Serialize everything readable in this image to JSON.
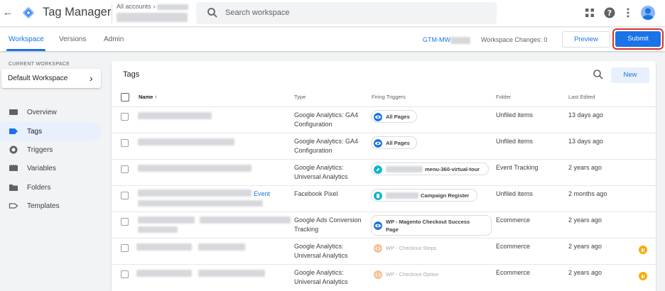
{
  "app": {
    "title": "Tag Manager",
    "accounts_label": "All accounts"
  },
  "search": {
    "placeholder": "Search workspace"
  },
  "subnav": {
    "tabs": [
      {
        "label": "Workspace"
      },
      {
        "label": "Versions"
      },
      {
        "label": "Admin"
      }
    ],
    "container_id_prefix": "GTM-MW",
    "workspace_changes": "Workspace Changes: 0",
    "preview_label": "Preview",
    "submit_label": "Submit"
  },
  "sidebar": {
    "current_workspace_label": "CURRENT WORKSPACE",
    "workspace_name": "Default Workspace",
    "items": [
      {
        "label": "Overview",
        "icon": "overview-icon"
      },
      {
        "label": "Tags",
        "icon": "tag-icon"
      },
      {
        "label": "Triggers",
        "icon": "trigger-icon"
      },
      {
        "label": "Variables",
        "icon": "variable-icon"
      },
      {
        "label": "Folders",
        "icon": "folder-icon"
      },
      {
        "label": "Templates",
        "icon": "template-icon"
      }
    ]
  },
  "tags": {
    "title": "Tags",
    "new_label": "New",
    "columns": {
      "name": "Name",
      "type": "Type",
      "triggers": "Firing Triggers",
      "folder": "Folder",
      "edited": "Last Edited"
    },
    "rows": [
      {
        "name_suffix": "",
        "type1": "Google Analytics: GA4",
        "type2": "Configuration",
        "trigger": "All Pages",
        "trigger_icon": "eye-icon",
        "folder": "Unfiled items",
        "edited": "13 days ago",
        "paused": false
      },
      {
        "name_suffix": "",
        "type1": "Google Analytics: GA4",
        "type2": "Configuration",
        "trigger": "All Pages",
        "trigger_icon": "eye-icon",
        "folder": "Unfiled items",
        "edited": "13 days ago",
        "paused": false
      },
      {
        "name_suffix": "",
        "type1": "Google Analytics:",
        "type2": "Universal Analytics",
        "trigger": "menu-360-virtual-tour",
        "trigger_icon": "link-icon",
        "folder": "Event Tracking",
        "edited": "2 years ago",
        "paused": false
      },
      {
        "name_suffix": "Event",
        "type1": "Facebook Pixel",
        "type2": "",
        "trigger": "Campaign Register",
        "trigger_icon": "hand-icon",
        "folder": "Unfiled items",
        "edited": "2 months ago",
        "paused": false
      },
      {
        "name_suffix": "",
        "type1": "Google Ads Conversion",
        "type2": "Tracking",
        "trigger": "WP - Magento Checkout Success",
        "trigger2": "Page",
        "trigger_icon": "eye-icon",
        "folder": "Ecommerce",
        "edited": "2 years ago",
        "paused": false
      },
      {
        "name_suffix": "",
        "type1": "Google Analytics:",
        "type2": "Universal Analytics",
        "trigger": "WP - Checkout Steps",
        "trigger_icon": "code-icon",
        "folder": "Ecommerce",
        "edited": "2 years ago",
        "paused": true
      },
      {
        "name_suffix": "",
        "type1": "Google Analytics:",
        "type2": "Universal Analytics",
        "trigger": "WP - Checkout Option",
        "trigger_icon": "code-icon",
        "folder": "Ecommerce",
        "edited": "2 years ago",
        "paused": true
      }
    ]
  },
  "colors": {
    "accent": "#1a73e8",
    "submit_highlight": "#d93025",
    "paused": "#f9ab00"
  }
}
